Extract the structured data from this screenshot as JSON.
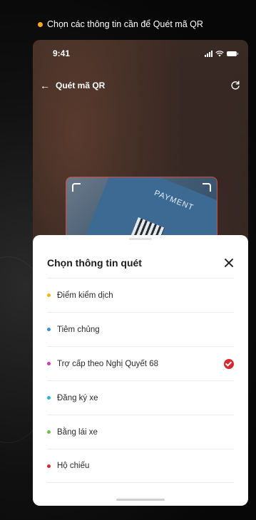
{
  "caption": {
    "text": "Chọn các thông tin cần để Quét mã QR",
    "dot_color": "#f5a623"
  },
  "status_bar": {
    "time": "9:41"
  },
  "header": {
    "title": "Quét mã QR",
    "back_icon": "arrow-left-icon",
    "refresh_icon": "refresh-icon"
  },
  "scanner": {
    "card_text": "PAYMENT",
    "frame_color": "#d3493a"
  },
  "sheet": {
    "title": "Chọn thông tin quét",
    "items": [
      {
        "label": "Điểm kiểm dịch",
        "dot_color": "#f2b705",
        "selected": false
      },
      {
        "label": "Tiêm chủng",
        "dot_color": "#3a8fd6",
        "selected": false
      },
      {
        "label": "Trợ cấp theo Nghị Quyết 68",
        "dot_color": "#d43ab0",
        "selected": true
      },
      {
        "label": "Đăng ký xe",
        "dot_color": "#27b7c9",
        "selected": false
      },
      {
        "label": "Bằng lái xe",
        "dot_color": "#6cc24a",
        "selected": false
      },
      {
        "label": "Hộ chiếu",
        "dot_color": "#d8282f",
        "selected": false
      }
    ],
    "check_color": "#d8282f"
  }
}
